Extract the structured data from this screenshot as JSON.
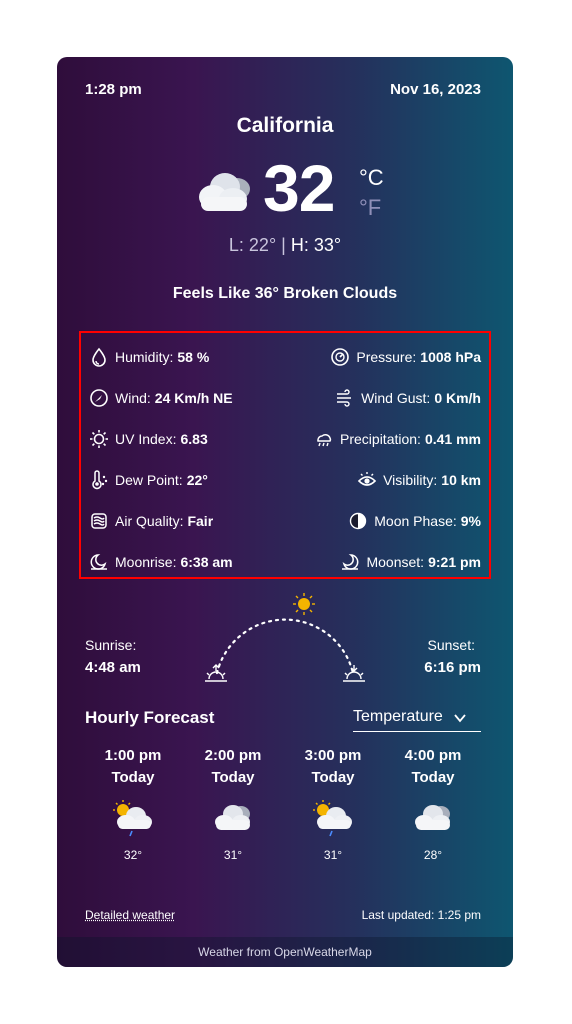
{
  "header": {
    "time": "1:28 pm",
    "date": "Nov 16, 2023"
  },
  "location": {
    "city": "California"
  },
  "current": {
    "icon": "broken-clouds-icon",
    "temperature": "32",
    "unit_c": "°C",
    "unit_f": "°F",
    "low": "L: 22°",
    "separator": "|",
    "high": "H: 33°",
    "feels_like": "Feels Like 36° Broken Clouds"
  },
  "details": {
    "humidity": {
      "label": "Humidity:",
      "value": "58 %",
      "icon": "humidity-drop-icon"
    },
    "pressure": {
      "label": "Pressure:",
      "value": "1008 hPa",
      "icon": "pressure-gauge-icon"
    },
    "wind": {
      "label": "Wind:",
      "value": "24 Km/h NE",
      "icon": "wind-compass-icon"
    },
    "wind_gust": {
      "label": "Wind Gust:",
      "value": "0 Km/h",
      "icon": "wind-gust-icon"
    },
    "uv_index": {
      "label": "UV Index:",
      "value": "6.83",
      "icon": "uv-sun-icon"
    },
    "precipitation": {
      "label": "Precipitation:",
      "value": "0.41 mm",
      "icon": "rain-cloud-icon"
    },
    "dew_point": {
      "label": "Dew Point:",
      "value": "22°",
      "icon": "thermometer-icon"
    },
    "visibility": {
      "label": "Visibility:",
      "value": "10 km",
      "icon": "eye-icon"
    },
    "air_quality": {
      "label": "Air Quality:",
      "value": "Fair",
      "icon": "air-quality-icon"
    },
    "moon_phase": {
      "label": "Moon Phase:",
      "value": "9%",
      "icon": "moon-phase-icon"
    },
    "moonrise": {
      "label": "Moonrise:",
      "value": "6:38 am",
      "icon": "moonrise-icon"
    },
    "moonset": {
      "label": "Moonset:",
      "value": "9:21 pm",
      "icon": "moonset-icon"
    }
  },
  "sun": {
    "sunrise_label": "Sunrise:",
    "sunrise_time": "4:48 am",
    "sunset_label": "Sunset:",
    "sunset_time": "6:16 pm"
  },
  "hourly": {
    "title": "Hourly Forecast",
    "selector_value": "Temperature",
    "items": [
      {
        "time": "1:00 pm",
        "day": "Today",
        "icon": "sun-cloud-rain-icon",
        "temp": "32°"
      },
      {
        "time": "2:00 pm",
        "day": "Today",
        "icon": "clouds-icon",
        "temp": "31°"
      },
      {
        "time": "3:00 pm",
        "day": "Today",
        "icon": "sun-cloud-rain-icon",
        "temp": "31°"
      },
      {
        "time": "4:00 pm",
        "day": "Today",
        "icon": "clouds-icon",
        "temp": "28°"
      }
    ]
  },
  "footer": {
    "detailed_link": "Detailed weather",
    "last_updated": "Last updated: 1:25 pm",
    "source": "Weather from OpenWeatherMap"
  },
  "colors": {
    "gradient_start": "#2f0d3b",
    "gradient_end": "#0e5670",
    "highlight_border": "#ff0000",
    "muted_unit": "#8f8fb8"
  }
}
